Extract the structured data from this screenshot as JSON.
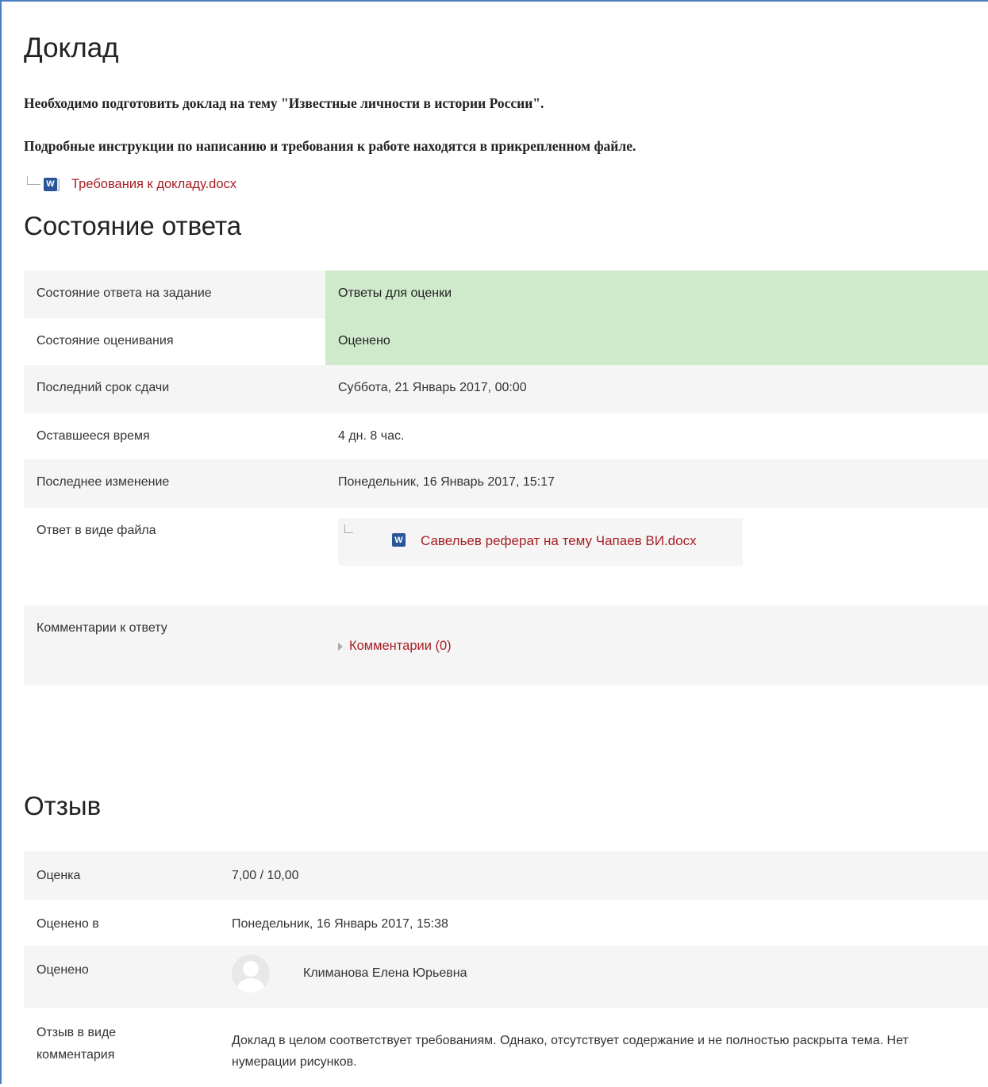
{
  "page": {
    "title": "Доклад",
    "intro_line1": "Необходимо подготовить доклад на тему \"Известные личности в истории России\".",
    "intro_line2": "Подробные инструкции по написанию и требования к работе находятся в прикрепленном файле.",
    "attachment": {
      "name": "Требования к докладу.docx",
      "icon": "word-doc-icon"
    }
  },
  "status": {
    "heading": "Состояние ответа",
    "rows": [
      {
        "label": "Состояние ответа на задание",
        "value": "Ответы для оценки"
      },
      {
        "label": "Состояние оценивания",
        "value": "Оценено"
      },
      {
        "label": "Последний срок сдачи",
        "value": "Суббота, 21 Январь 2017, 00:00"
      },
      {
        "label": "Оставшееся время",
        "value": "4 дн. 8 час."
      },
      {
        "label": "Последнее изменение",
        "value": "Понедельник, 16 Январь 2017, 15:17"
      },
      {
        "label": "Ответ в виде файла",
        "value": "Савельев реферат на тему Чапаев ВИ.docx"
      },
      {
        "label": "Комментарии к ответу",
        "value": "Комментарии (0)"
      }
    ],
    "highlight_color": "#cfeacb"
  },
  "feedback": {
    "heading": "Отзыв",
    "rows": [
      {
        "label": "Оценка",
        "value": "7,00 / 10,00"
      },
      {
        "label": "Оценено в",
        "value": "Понедельник, 16 Январь 2017, 15:38"
      },
      {
        "label": "Оценено",
        "value": "Климанова Елена Юрьевна"
      },
      {
        "label": "Отзыв в виде комментария",
        "value": "Доклад в целом соответствует требованиям. Однако, отсутствует содержание и не полностью раскрыта тема. Нет нумерации рисунков."
      }
    ]
  },
  "colors": {
    "link": "#a61f24",
    "frame": "#4a7fc1",
    "row_alt": "#f5f5f5"
  }
}
